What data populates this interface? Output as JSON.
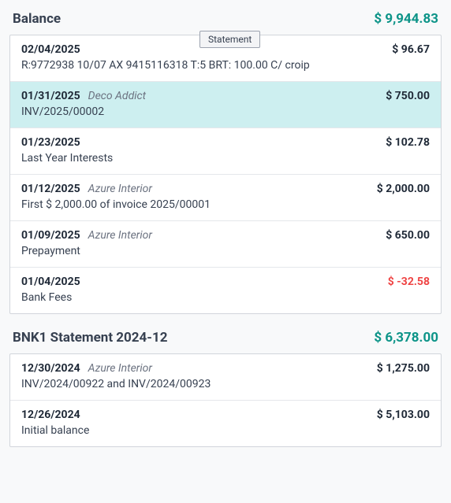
{
  "tooltip": "Statement",
  "sections": [
    {
      "title": "Balance",
      "amount": "$ 9,944.83",
      "rows": [
        {
          "date": "02/04/2025",
          "partner": "",
          "amount": "$ 96.67",
          "desc": "R:9772938 10/07 AX 9415116318 T:5 BRT: 100.00 C/ croip",
          "neg": false,
          "hl": false,
          "showTooltip": true
        },
        {
          "date": "01/31/2025",
          "partner": "Deco Addict",
          "amount": "$ 750.00",
          "desc": "INV/2025/00002",
          "neg": false,
          "hl": true,
          "showTooltip": false
        },
        {
          "date": "01/23/2025",
          "partner": "",
          "amount": "$ 102.78",
          "desc": "Last Year Interests",
          "neg": false,
          "hl": false,
          "showTooltip": false
        },
        {
          "date": "01/12/2025",
          "partner": "Azure Interior",
          "amount": "$ 2,000.00",
          "desc": "First $ 2,000.00 of invoice 2025/00001",
          "neg": false,
          "hl": false,
          "showTooltip": false
        },
        {
          "date": "01/09/2025",
          "partner": "Azure Interior",
          "amount": "$ 650.00",
          "desc": "Prepayment",
          "neg": false,
          "hl": false,
          "showTooltip": false
        },
        {
          "date": "01/04/2025",
          "partner": "",
          "amount": "$ -32.58",
          "desc": "Bank Fees",
          "neg": true,
          "hl": false,
          "showTooltip": false
        }
      ]
    },
    {
      "title": "BNK1 Statement 2024-12",
      "amount": "$ 6,378.00",
      "rows": [
        {
          "date": "12/30/2024",
          "partner": "Azure Interior",
          "amount": "$ 1,275.00",
          "desc": "INV/2024/00922 and INV/2024/00923",
          "neg": false,
          "hl": false,
          "showTooltip": false
        },
        {
          "date": "12/26/2024",
          "partner": "",
          "amount": "$ 5,103.00",
          "desc": "Initial balance",
          "neg": false,
          "hl": false,
          "showTooltip": false
        }
      ]
    }
  ]
}
